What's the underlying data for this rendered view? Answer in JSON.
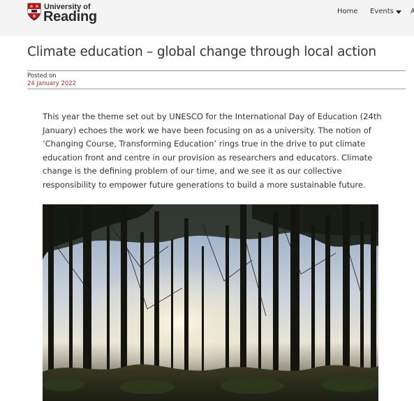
{
  "header": {
    "logo_line1": "University of",
    "logo_line2": "Reading",
    "nav": [
      {
        "label": "Home"
      },
      {
        "label": "Events"
      },
      {
        "label": "A"
      }
    ]
  },
  "article": {
    "title": "Climate education – global change through local action",
    "posted_label": "Posted on",
    "posted_date": "24 January 2022",
    "paragraph": "This year the theme set out by UNESCO for the International Day of Education (24th January) echoes the work we have been focusing on as a university. The notion of ‘Changing Course, Transforming Education’ rings true in the drive to put climate education front and centre in our provision as researchers and educators. Climate change is the defining problem of our time, and we see it as our collective responsibility to empower future generations to build a more sustainable future."
  },
  "colors": {
    "header_bg": "#f4f4f4",
    "date_red": "#b0282c",
    "crest_red": "#c8102e",
    "crest_gold": "#f1b434"
  }
}
